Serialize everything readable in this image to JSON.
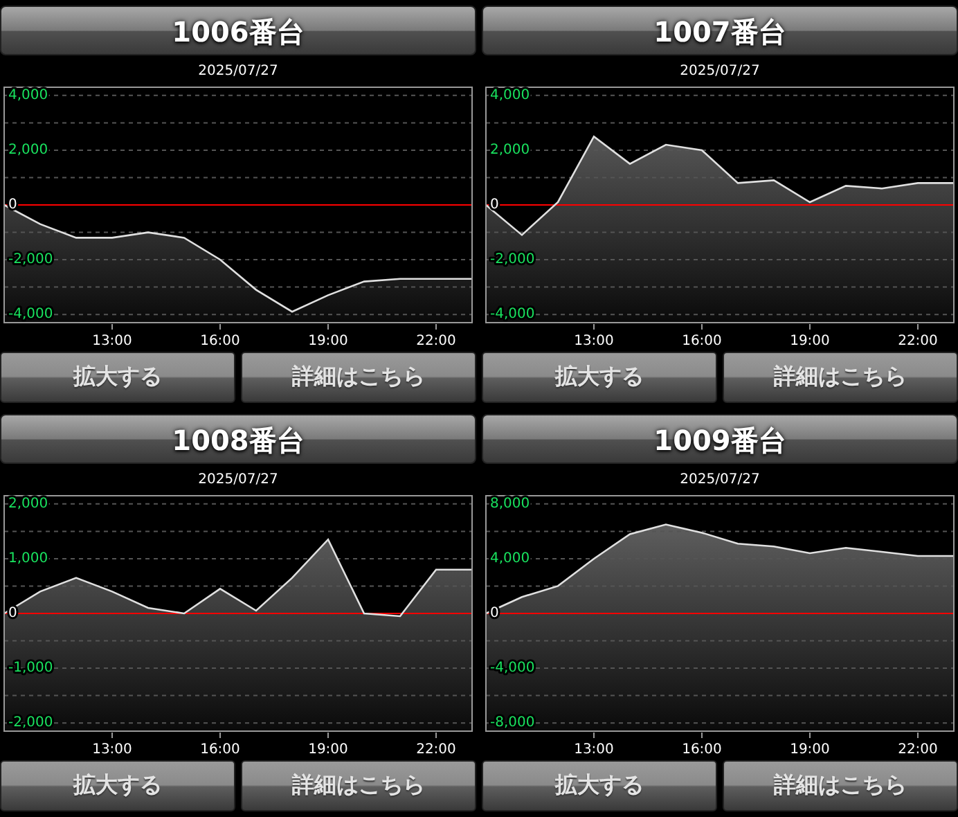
{
  "panels": [
    {
      "title": "1006番台",
      "date": "2025/07/27",
      "chart_data": {
        "type": "line",
        "x": [
          10,
          11,
          12,
          13,
          14,
          15,
          16,
          17,
          18,
          19,
          20,
          21,
          22,
          23
        ],
        "xlim": [
          10,
          23
        ],
        "ylim": [
          -4300,
          4300
        ],
        "xticks": [
          {
            "value": 13,
            "label": "13:00"
          },
          {
            "value": 16,
            "label": "16:00"
          },
          {
            "value": 19,
            "label": "19:00"
          },
          {
            "value": 22,
            "label": "22:00"
          }
        ],
        "yticks": [
          {
            "value": 4000,
            "label": "4,000"
          },
          {
            "value": 2000,
            "label": "2,000"
          },
          {
            "value": 0,
            "label": "0"
          },
          {
            "value": -2000,
            "label": "-2,000"
          },
          {
            "value": -4000,
            "label": "-4,000"
          }
        ],
        "grid": true,
        "ref_lines": [
          {
            "axis": "y",
            "value": 0,
            "color": "#ff0000"
          }
        ],
        "series": [
          {
            "color": "#e0e0e0",
            "values": [
              0,
              -700,
              -1200,
              -1200,
              -1000,
              -1200,
              -2000,
              -3100,
              -3900,
              -3300,
              -2800,
              -2700,
              -2700,
              -2700
            ]
          }
        ]
      },
      "buttons": [
        "拡大する",
        "詳細はこちら"
      ]
    },
    {
      "title": "1007番台",
      "date": "2025/07/27",
      "chart_data": {
        "type": "line",
        "x": [
          10,
          11,
          12,
          13,
          14,
          15,
          16,
          17,
          18,
          19,
          20,
          21,
          22,
          23
        ],
        "xlim": [
          10,
          23
        ],
        "ylim": [
          -4300,
          4300
        ],
        "xticks": [
          {
            "value": 13,
            "label": "13:00"
          },
          {
            "value": 16,
            "label": "16:00"
          },
          {
            "value": 19,
            "label": "19:00"
          },
          {
            "value": 22,
            "label": "22:00"
          }
        ],
        "yticks": [
          {
            "value": 4000,
            "label": "4,000"
          },
          {
            "value": 2000,
            "label": "2,000"
          },
          {
            "value": 0,
            "label": "0"
          },
          {
            "value": -2000,
            "label": "-2,000"
          },
          {
            "value": -4000,
            "label": "-4,000"
          }
        ],
        "grid": true,
        "ref_lines": [
          {
            "axis": "y",
            "value": 0,
            "color": "#ff0000"
          }
        ],
        "series": [
          {
            "color": "#e0e0e0",
            "values": [
              0,
              -1100,
              100,
              2500,
              1500,
              2200,
              2000,
              800,
              900,
              100,
              700,
              600,
              800,
              800
            ]
          }
        ]
      },
      "buttons": [
        "拡大する",
        "詳細はこちら"
      ]
    },
    {
      "title": "1008番台",
      "date": "2025/07/27",
      "chart_data": {
        "type": "line",
        "x": [
          10,
          11,
          12,
          13,
          14,
          15,
          16,
          17,
          18,
          19,
          20,
          21,
          22,
          23
        ],
        "xlim": [
          10,
          23
        ],
        "ylim": [
          -2150,
          2150
        ],
        "xticks": [
          {
            "value": 13,
            "label": "13:00"
          },
          {
            "value": 16,
            "label": "16:00"
          },
          {
            "value": 19,
            "label": "19:00"
          },
          {
            "value": 22,
            "label": "22:00"
          }
        ],
        "yticks": [
          {
            "value": 2000,
            "label": "2,000"
          },
          {
            "value": 1000,
            "label": "1,000"
          },
          {
            "value": 0,
            "label": "0"
          },
          {
            "value": -1000,
            "label": "-1,000"
          },
          {
            "value": -2000,
            "label": "-2,000"
          }
        ],
        "grid": true,
        "ref_lines": [
          {
            "axis": "y",
            "value": 0,
            "color": "#ff0000"
          }
        ],
        "series": [
          {
            "color": "#e0e0e0",
            "values": [
              0,
              400,
              650,
              400,
              100,
              0,
              450,
              50,
              650,
              1350,
              0,
              -50,
              800,
              800
            ]
          }
        ]
      },
      "buttons": [
        "拡大する",
        "詳細はこちら"
      ]
    },
    {
      "title": "1009番台",
      "date": "2025/07/27",
      "chart_data": {
        "type": "line",
        "x": [
          10,
          11,
          12,
          13,
          14,
          15,
          16,
          17,
          18,
          19,
          20,
          21,
          22,
          23
        ],
        "xlim": [
          10,
          23
        ],
        "ylim": [
          -8600,
          8600
        ],
        "xticks": [
          {
            "value": 13,
            "label": "13:00"
          },
          {
            "value": 16,
            "label": "16:00"
          },
          {
            "value": 19,
            "label": "19:00"
          },
          {
            "value": 22,
            "label": "22:00"
          }
        ],
        "yticks": [
          {
            "value": 8000,
            "label": "8,000"
          },
          {
            "value": 4000,
            "label": "4,000"
          },
          {
            "value": 0,
            "label": "0"
          },
          {
            "value": -4000,
            "label": "-4,000"
          },
          {
            "value": -8000,
            "label": "-8,000"
          }
        ],
        "grid": true,
        "ref_lines": [
          {
            "axis": "y",
            "value": 0,
            "color": "#ff0000"
          }
        ],
        "series": [
          {
            "color": "#e0e0e0",
            "values": [
              0,
              1200,
              2000,
              4000,
              5800,
              6500,
              5900,
              5100,
              4900,
              4400,
              4800,
              4500,
              4200,
              4200
            ]
          }
        ]
      },
      "buttons": [
        "拡大する",
        "詳細はこちら"
      ]
    }
  ]
}
